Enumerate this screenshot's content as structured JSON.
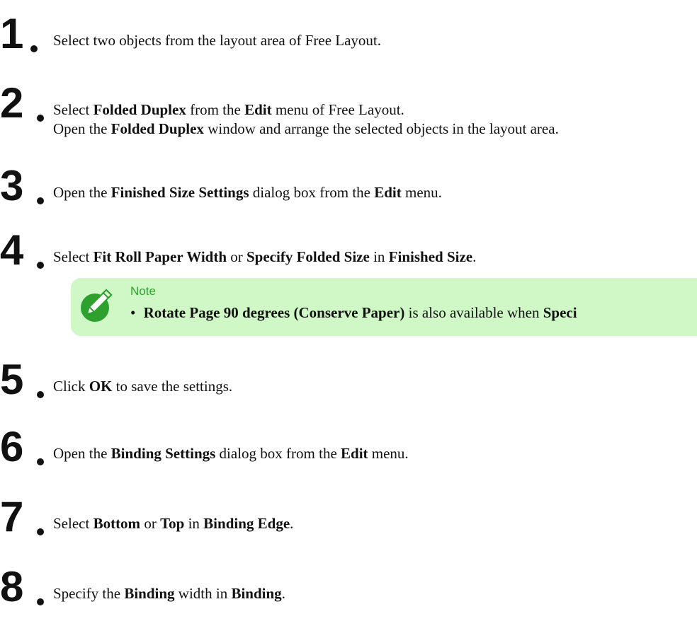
{
  "steps": [
    {
      "number": "1",
      "line1": [
        {
          "t": "Select two objects from the layout area of Free Layout.",
          "b": false
        }
      ]
    },
    {
      "number": "2",
      "line1": [
        {
          "t": "Select ",
          "b": false
        },
        {
          "t": "Folded Duplex",
          "b": true
        },
        {
          "t": " from the ",
          "b": false
        },
        {
          "t": "Edit",
          "b": true
        },
        {
          "t": " menu of Free Layout.",
          "b": false
        }
      ],
      "line2": [
        {
          "t": "Open the ",
          "b": false
        },
        {
          "t": "Folded Duplex",
          "b": true
        },
        {
          "t": " window and arrange the selected objects in the layout area.",
          "b": false
        }
      ]
    },
    {
      "number": "3",
      "line1": [
        {
          "t": "Open the ",
          "b": false
        },
        {
          "t": "Finished Size Settings",
          "b": true
        },
        {
          "t": " dialog box from the ",
          "b": false
        },
        {
          "t": "Edit",
          "b": true
        },
        {
          "t": " menu.",
          "b": false
        }
      ]
    },
    {
      "number": "4",
      "line1": [
        {
          "t": "Select ",
          "b": false
        },
        {
          "t": "Fit Roll Paper Width",
          "b": true
        },
        {
          "t": " or ",
          "b": false
        },
        {
          "t": "Specify Folded Size",
          "b": true
        },
        {
          "t": " in ",
          "b": false
        },
        {
          "t": "Finished Size",
          "b": true
        },
        {
          "t": ".",
          "b": false
        }
      ]
    },
    {
      "number": "5",
      "line1": [
        {
          "t": "Click ",
          "b": false
        },
        {
          "t": "OK",
          "b": true
        },
        {
          "t": " to save the settings.",
          "b": false
        }
      ]
    },
    {
      "number": "6",
      "line1": [
        {
          "t": "Open the ",
          "b": false
        },
        {
          "t": "Binding Settings",
          "b": true
        },
        {
          "t": " dialog box from the ",
          "b": false
        },
        {
          "t": "Edit",
          "b": true
        },
        {
          "t": " menu.",
          "b": false
        }
      ]
    },
    {
      "number": "7",
      "line1": [
        {
          "t": "Select ",
          "b": false
        },
        {
          "t": "Bottom",
          "b": true
        },
        {
          "t": " or ",
          "b": false
        },
        {
          "t": "Top",
          "b": true
        },
        {
          "t": " in ",
          "b": false
        },
        {
          "t": "Binding Edge",
          "b": true
        },
        {
          "t": ".",
          "b": false
        }
      ]
    },
    {
      "number": "8",
      "line1": [
        {
          "t": "Specify the ",
          "b": false
        },
        {
          "t": "Binding",
          "b": true
        },
        {
          "t": " width in ",
          "b": false
        },
        {
          "t": "Binding",
          "b": true
        },
        {
          "t": ".",
          "b": false
        }
      ]
    }
  ],
  "note": {
    "title": "Note",
    "bullet": "•",
    "line": [
      {
        "t": "Rotate Page 90 degrees (Conserve Paper)",
        "b": true
      },
      {
        "t": " is also available when ",
        "b": false
      },
      {
        "t": "Speci",
        "b": true
      }
    ],
    "icon": "note-pencil-icon",
    "accent_color": "#2ea02e",
    "background_color": "#cff8c6"
  }
}
